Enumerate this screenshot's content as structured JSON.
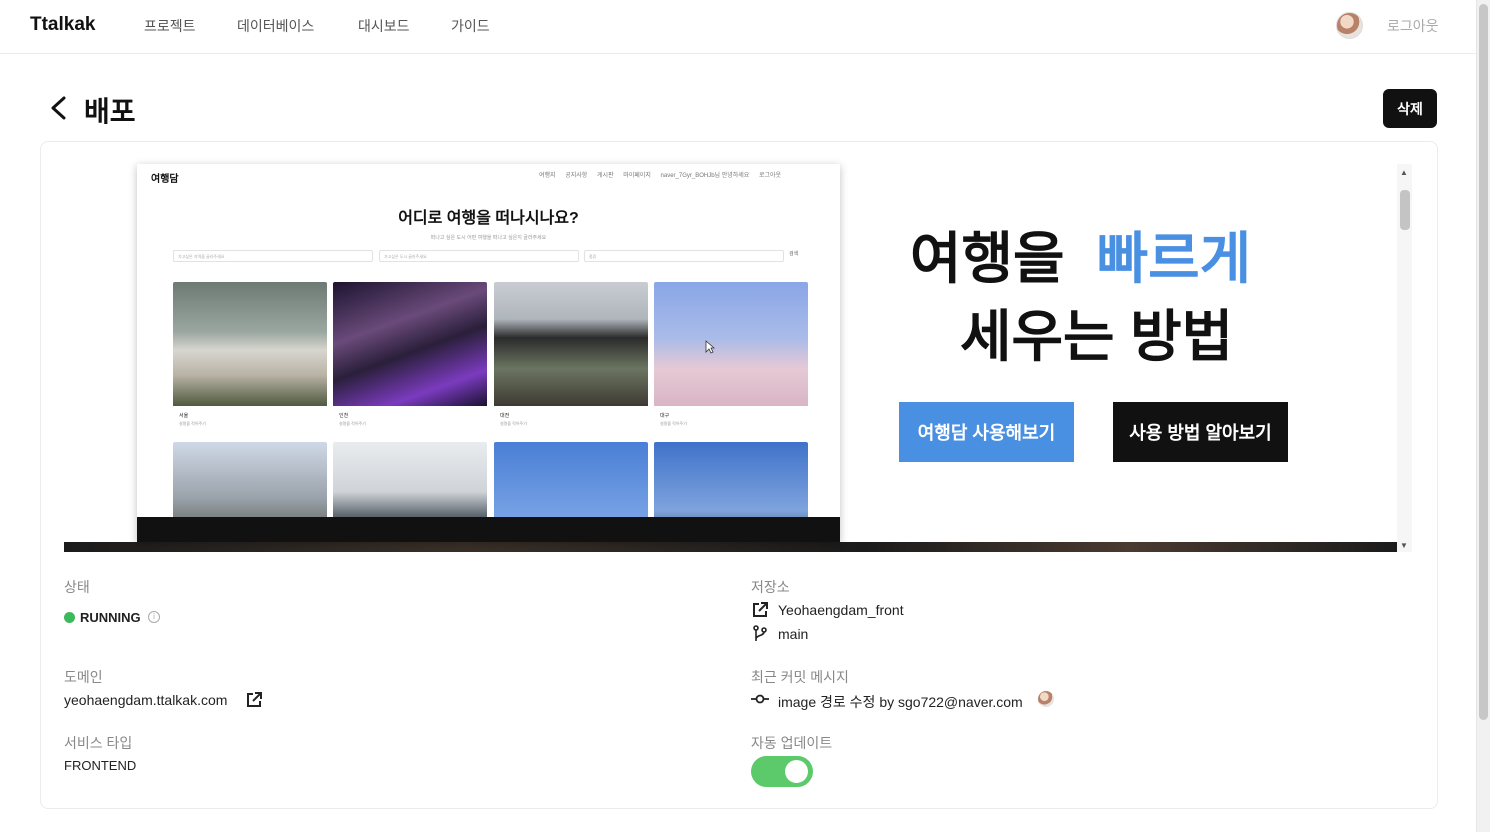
{
  "nav": {
    "brand": "Ttalkak",
    "links": [
      "프로젝트",
      "데이터베이스",
      "대시보드",
      "가이드"
    ],
    "logout": "로그아웃"
  },
  "header": {
    "title": "배포",
    "delete_label": "삭제"
  },
  "preview": {
    "site": {
      "logo": "여행담",
      "nav_items": [
        "여행지",
        "공지사항",
        "게시판",
        "마이페이지",
        "naver_7Gyr_BOHJb님 안녕하세요",
        "로그아웃"
      ],
      "heading": "어디로 여행을 떠나시나요?",
      "subheading": "떠나고 싶은 도시 어떤 여행을 떠나고 싶은지 골라주세요",
      "selects": [
        "가고싶은 지역을 골라주세요",
        "가고싶은 도시 골라주세요",
        "종류"
      ],
      "search": "검색",
      "tiles": [
        {
          "name": "서울",
          "desc": "설명을 적어주기"
        },
        {
          "name": "인천",
          "desc": "설명을 적어주기"
        },
        {
          "name": "대전",
          "desc": "설명을 적어주기"
        },
        {
          "name": "대구",
          "desc": "설명을 적어주기"
        }
      ]
    },
    "hero": {
      "line1": "여행을",
      "accent": "빠르게",
      "line2": "세우는 방법",
      "btn_primary": "여행담 사용해보기",
      "btn_secondary": "사용 방법 알아보기"
    }
  },
  "info": {
    "status_label": "상태",
    "status_value": "RUNNING",
    "domain_label": "도메인",
    "domain_value": "yeohaengdam.ttalkak.com",
    "service_type_label": "서비스 타입",
    "service_type_value": "FRONTEND",
    "repo_label": "저장소",
    "repo_name": "Yeohaengdam_front",
    "branch": "main",
    "commit_label": "최근 커밋 메시지",
    "commit_message": "image 경로 수정 by sgo722@naver.com",
    "auto_update_label": "자동 업데이트",
    "auto_update_on": true
  },
  "colors": {
    "accent": "#4a90e2",
    "running": "#3cb95b",
    "toggle_on": "#5cc96a"
  }
}
